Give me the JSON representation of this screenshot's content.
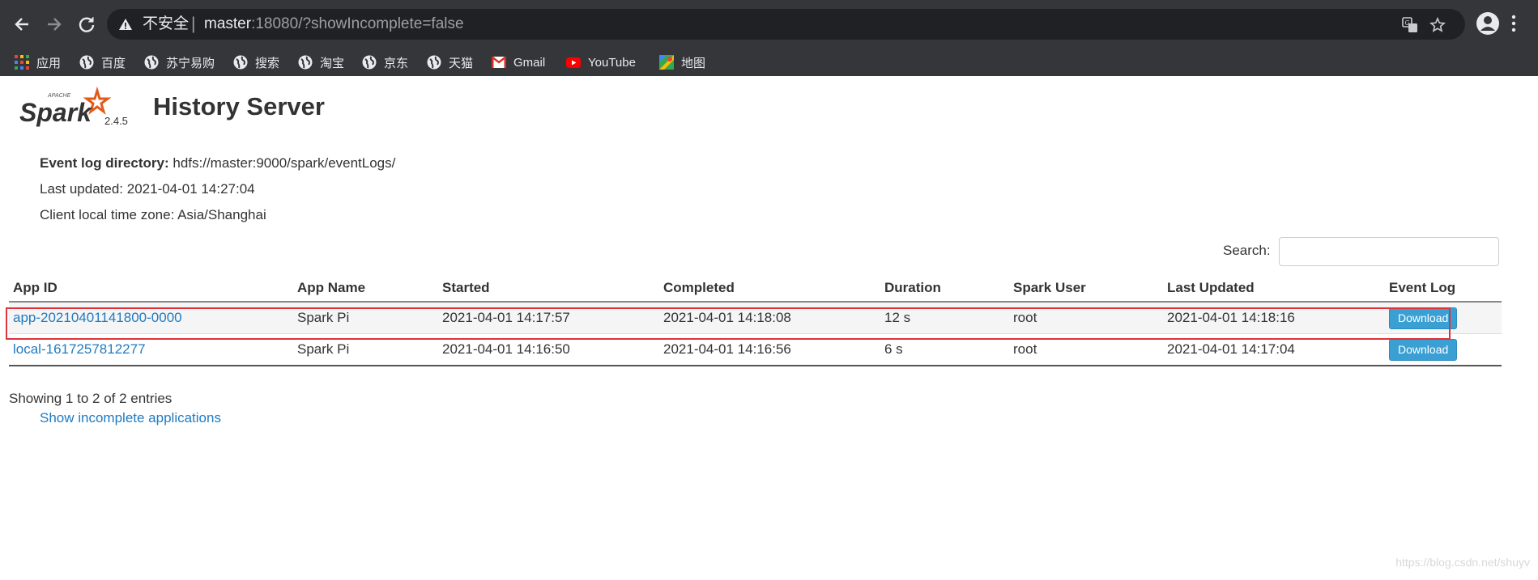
{
  "browser": {
    "security_label": "不安全",
    "separator": "|",
    "url_host": "master",
    "url_rest": ":18080/?showIncomplete=false",
    "bookmarks": [
      {
        "label": "应用",
        "icon": "apps-grid-icon"
      },
      {
        "label": "百度",
        "icon": "globe-icon"
      },
      {
        "label": "苏宁易购",
        "icon": "globe-icon"
      },
      {
        "label": "搜索",
        "icon": "globe-icon"
      },
      {
        "label": "淘宝",
        "icon": "globe-icon"
      },
      {
        "label": "京东",
        "icon": "globe-icon"
      },
      {
        "label": "天猫",
        "icon": "globe-icon"
      },
      {
        "label": "Gmail",
        "icon": "gmail-icon"
      },
      {
        "label": "YouTube",
        "icon": "youtube-icon"
      },
      {
        "label": "地图",
        "icon": "maps-icon"
      }
    ]
  },
  "header": {
    "logo_text": "Spark",
    "logo_small": "APACHE",
    "version": "2.4.5",
    "title": "History Server"
  },
  "info": {
    "event_log_label": "Event log directory:",
    "event_log_value": "hdfs://master:9000/spark/eventLogs/",
    "last_updated": "Last updated: 2021-04-01 14:27:04",
    "timezone": "Client local time zone: Asia/Shanghai"
  },
  "search": {
    "label": "Search:",
    "value": ""
  },
  "table": {
    "columns": [
      "App ID",
      "App Name",
      "Started",
      "Completed",
      "Duration",
      "Spark User",
      "Last Updated",
      "Event Log"
    ],
    "rows": [
      {
        "app_id": "app-20210401141800-0000",
        "app_name": "Spark Pi",
        "started": "2021-04-01 14:17:57",
        "completed": "2021-04-01 14:18:08",
        "duration": "12 s",
        "user": "root",
        "last_updated": "2021-04-01 14:18:16",
        "event_log": "Download"
      },
      {
        "app_id": "local-1617257812277",
        "app_name": "Spark Pi",
        "started": "2021-04-01 14:16:50",
        "completed": "2021-04-01 14:16:56",
        "duration": "6 s",
        "user": "root",
        "last_updated": "2021-04-01 14:17:04",
        "event_log": "Download"
      }
    ]
  },
  "footer": {
    "entries": "Showing 1 to 2 of 2 entries",
    "incomplete_link": "Show incomplete applications",
    "watermark": "https://blog.csdn.net/shuyv"
  },
  "colors": {
    "chrome": "#35363a",
    "omnibox": "#202124",
    "link": "#1f7bc1",
    "download_button": "#3aa0d4",
    "highlight": "#e0323b",
    "spark_orange": "#e25a1c"
  }
}
